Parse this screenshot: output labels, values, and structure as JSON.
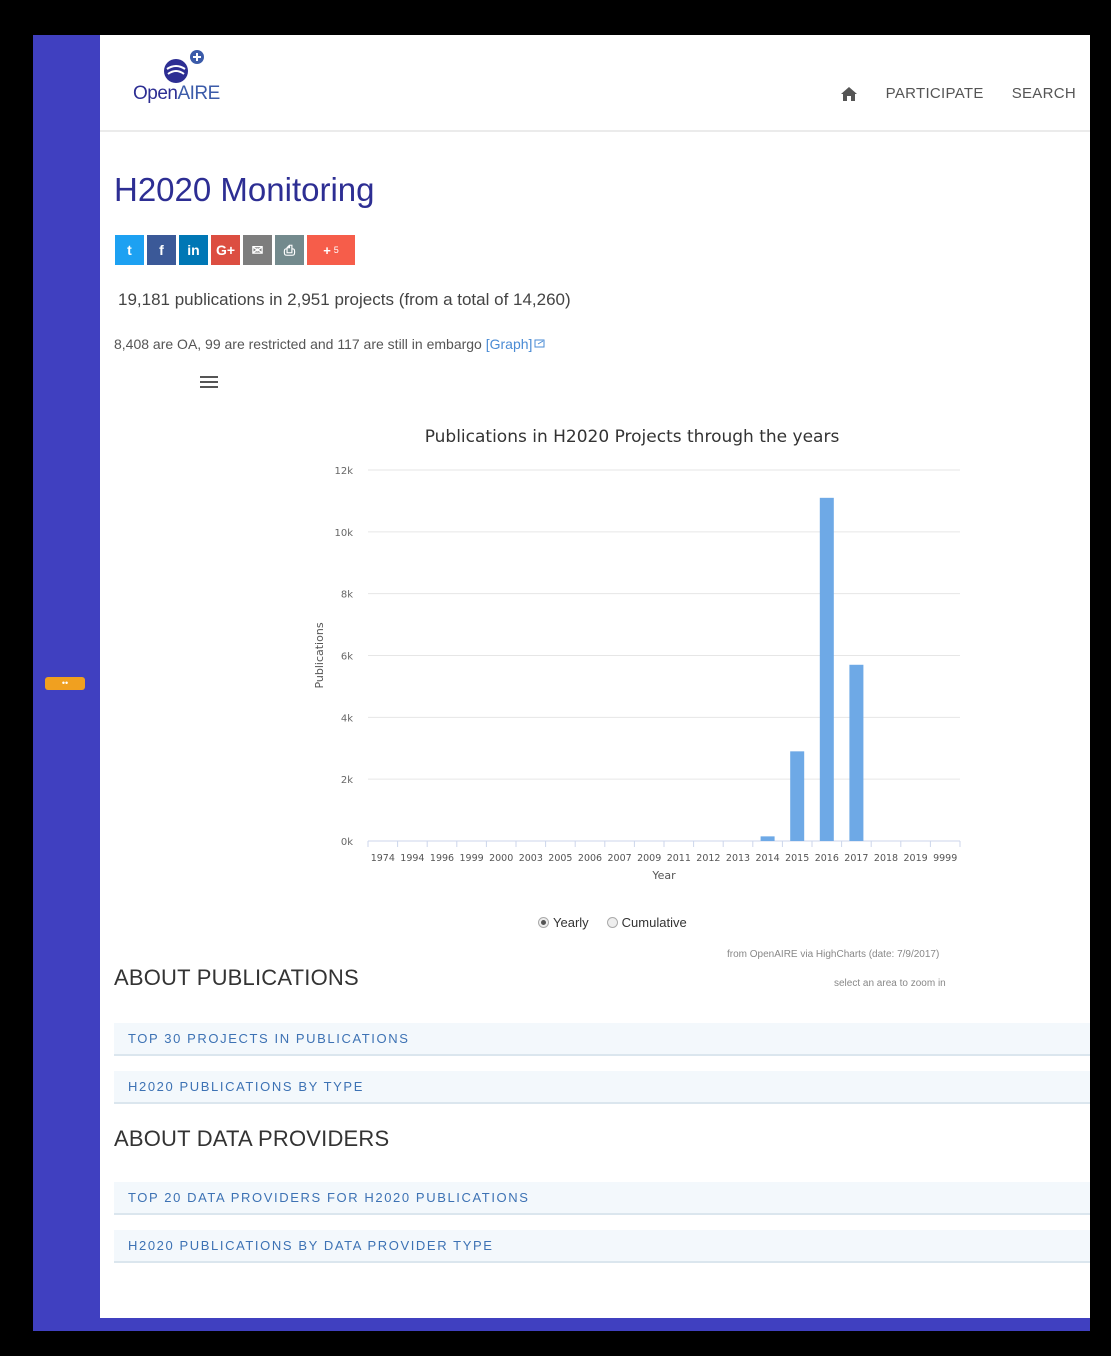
{
  "brand": {
    "name_prefix": "Open",
    "name_suffix": "AIRE"
  },
  "nav": {
    "participate": "PARTICIPATE",
    "search": "SEARCH"
  },
  "title": "H2020 Monitoring",
  "share": [
    {
      "icon": "twitter-icon",
      "glyph": "t",
      "color": "#1da1f2"
    },
    {
      "icon": "facebook-icon",
      "glyph": "f",
      "color": "#3b5998"
    },
    {
      "icon": "linkedin-icon",
      "glyph": "in",
      "color": "#0077b5"
    },
    {
      "icon": "google-plus-icon",
      "glyph": "G+",
      "color": "#dc4e41"
    },
    {
      "icon": "email-icon",
      "glyph": "✉",
      "color": "#7d7d7d"
    },
    {
      "icon": "print-icon",
      "glyph": "⎙",
      "color": "#738a8d"
    }
  ],
  "share_more": {
    "label": "+",
    "count": "5",
    "color": "#f65d4a"
  },
  "stats": {
    "main": "19,181 publications in 2,951 projects (from a total of 14,260)",
    "sub": "8,408 are OA, 99 are restricted and 117 are still in embargo",
    "graph_link": "[Graph]"
  },
  "chart_data": {
    "type": "bar",
    "title": "Publications in H2020 Projects through the years",
    "xlabel": "Year",
    "ylabel": "Publications",
    "categories": [
      "1974",
      "1994",
      "1996",
      "1999",
      "2000",
      "2003",
      "2005",
      "2006",
      "2007",
      "2009",
      "2011",
      "2012",
      "2013",
      "2014",
      "2015",
      "2016",
      "2017",
      "2018",
      "2019",
      "9999"
    ],
    "values": [
      0,
      0,
      0,
      0,
      0,
      0,
      0,
      0,
      0,
      0,
      0,
      0,
      0,
      150,
      2900,
      11100,
      5700,
      0,
      0,
      0
    ],
    "ylim": [
      0,
      12000
    ],
    "yticks": [
      0,
      2000,
      4000,
      6000,
      8000,
      10000,
      12000
    ],
    "ytick_labels": [
      "0k",
      "2k",
      "4k",
      "6k",
      "8k",
      "10k",
      "12k"
    ],
    "grid": true,
    "color": "#6ea9e6"
  },
  "chart_controls": {
    "yearly": "Yearly",
    "cumulative": "Cumulative",
    "credit": "from OpenAIRE via HighCharts (date: 7/9/2017)",
    "zoom_hint": "select an area to zoom in"
  },
  "sections": {
    "publications_title": "ABOUT PUBLICATIONS",
    "publications_links": [
      "TOP 30 PROJECTS IN PUBLICATIONS",
      "H2020 PUBLICATIONS BY TYPE"
    ],
    "providers_title": "ABOUT DATA PROVIDERS",
    "providers_links": [
      "TOP 20 DATA PROVIDERS FOR H2020 PUBLICATIONS",
      "H2020 PUBLICATIONS BY DATA PROVIDER TYPE"
    ]
  }
}
